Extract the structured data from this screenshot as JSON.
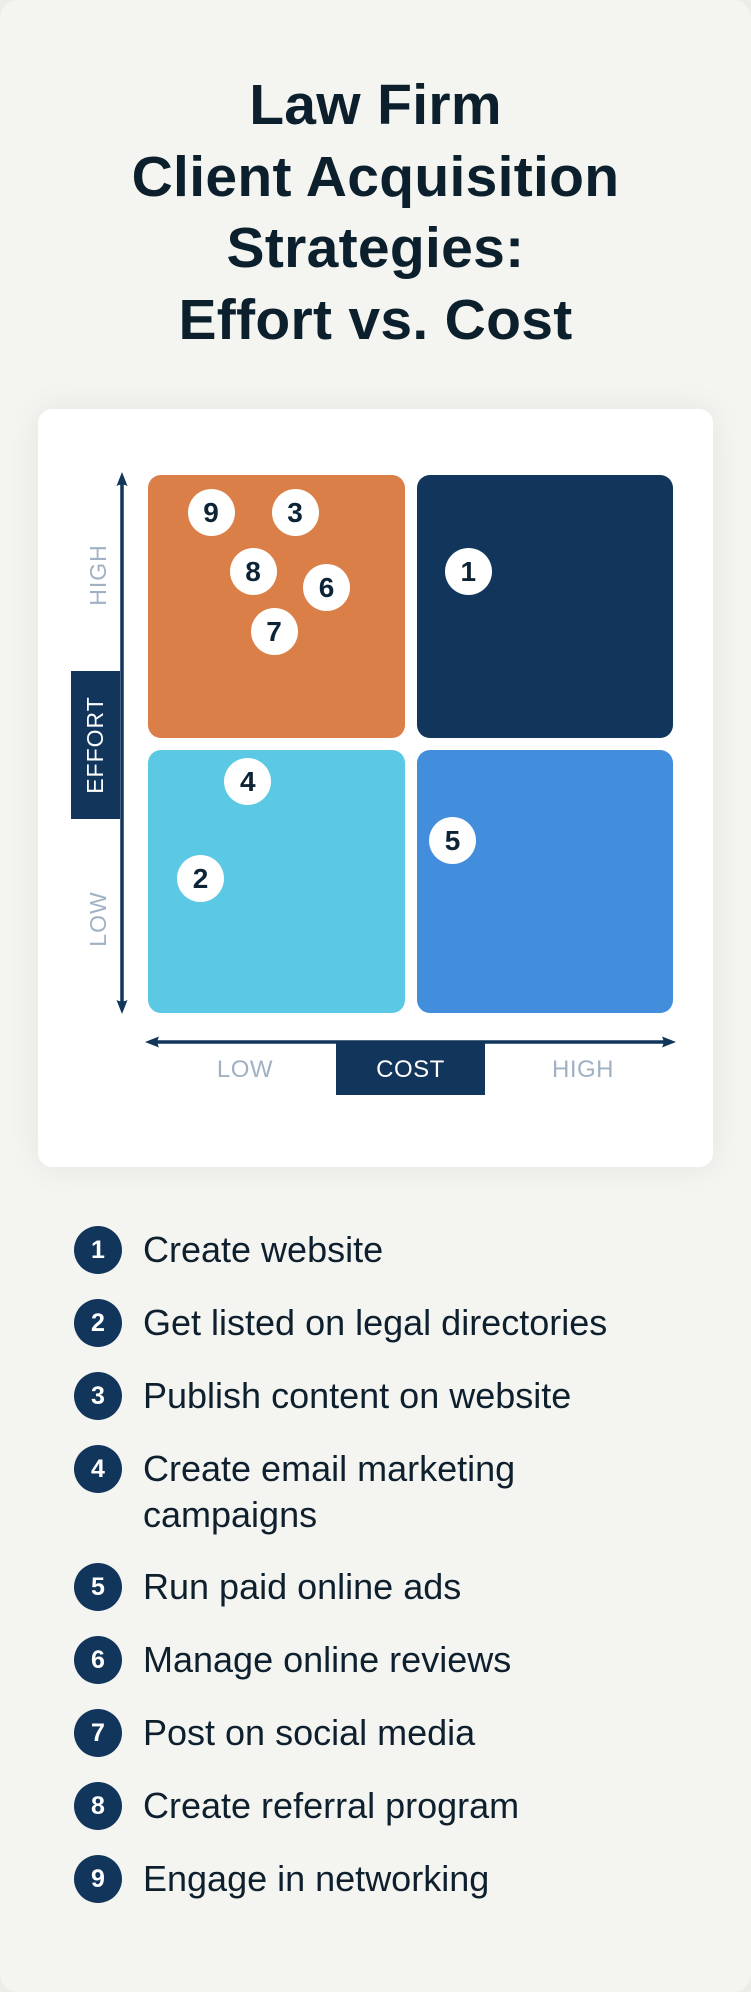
{
  "title": {
    "lines": [
      "Law Firm",
      "Client Acquisition",
      "Strategies:",
      "Effort vs. Cost"
    ]
  },
  "chart_data": {
    "type": "scatter",
    "title": "Law Firm Client Acquisition Strategies: Effort vs. Cost",
    "xlabel": "COST",
    "ylabel": "EFFORT",
    "x_ticks": [
      "LOW",
      "HIGH"
    ],
    "y_ticks": [
      "LOW",
      "HIGH"
    ],
    "xlim": [
      0,
      1
    ],
    "ylim": [
      0,
      1
    ],
    "grid": false,
    "quadrants": [
      {
        "name": "low-cost-high-effort",
        "x_range": [
          0,
          0.5
        ],
        "y_range": [
          0.5,
          1
        ],
        "color": "#db7f48"
      },
      {
        "name": "high-cost-high-effort",
        "x_range": [
          0.5,
          1
        ],
        "y_range": [
          0.5,
          1
        ],
        "color": "#11355b"
      },
      {
        "name": "low-cost-low-effort",
        "x_range": [
          0,
          0.5
        ],
        "y_range": [
          0,
          0.5
        ],
        "color": "#5bc8e4"
      },
      {
        "name": "high-cost-low-effort",
        "x_range": [
          0.5,
          1
        ],
        "y_range": [
          0,
          0.5
        ],
        "color": "#428edd"
      }
    ],
    "points": [
      {
        "label": "1",
        "name": "Create website",
        "x": 0.61,
        "y": 0.82
      },
      {
        "label": "2",
        "name": "Get listed on legal directories",
        "x": 0.1,
        "y": 0.25
      },
      {
        "label": "3",
        "name": "Publish content on website",
        "x": 0.28,
        "y": 0.93
      },
      {
        "label": "4",
        "name": "Create email marketing campaigns",
        "x": 0.19,
        "y": 0.43
      },
      {
        "label": "5",
        "name": "Run paid online ads",
        "x": 0.58,
        "y": 0.32
      },
      {
        "label": "6",
        "name": "Manage online reviews",
        "x": 0.34,
        "y": 0.79
      },
      {
        "label": "7",
        "name": "Post on social media",
        "x": 0.24,
        "y": 0.71
      },
      {
        "label": "8",
        "name": "Create referral program",
        "x": 0.2,
        "y": 0.82
      },
      {
        "label": "9",
        "name": "Engage in networking",
        "x": 0.12,
        "y": 0.93
      }
    ]
  },
  "axes": {
    "effort_label": "EFFORT",
    "cost_label": "COST",
    "y_high": "HIGH",
    "y_low": "LOW",
    "x_low": "LOW",
    "x_high": "HIGH",
    "axis_color": "#11355b",
    "tick_color": "#a0b1c4"
  },
  "legend": [
    {
      "number": "1",
      "text": "Create website"
    },
    {
      "number": "2",
      "text": "Get listed on legal directories"
    },
    {
      "number": "3",
      "text": "Publish content on website"
    },
    {
      "number": "4",
      "text": "Create email marketing campaigns"
    },
    {
      "number": "5",
      "text": "Run paid online ads"
    },
    {
      "number": "6",
      "text": "Manage online reviews"
    },
    {
      "number": "7",
      "text": "Post on social media"
    },
    {
      "number": "8",
      "text": "Create referral program"
    },
    {
      "number": "9",
      "text": "Engage in networking"
    }
  ]
}
